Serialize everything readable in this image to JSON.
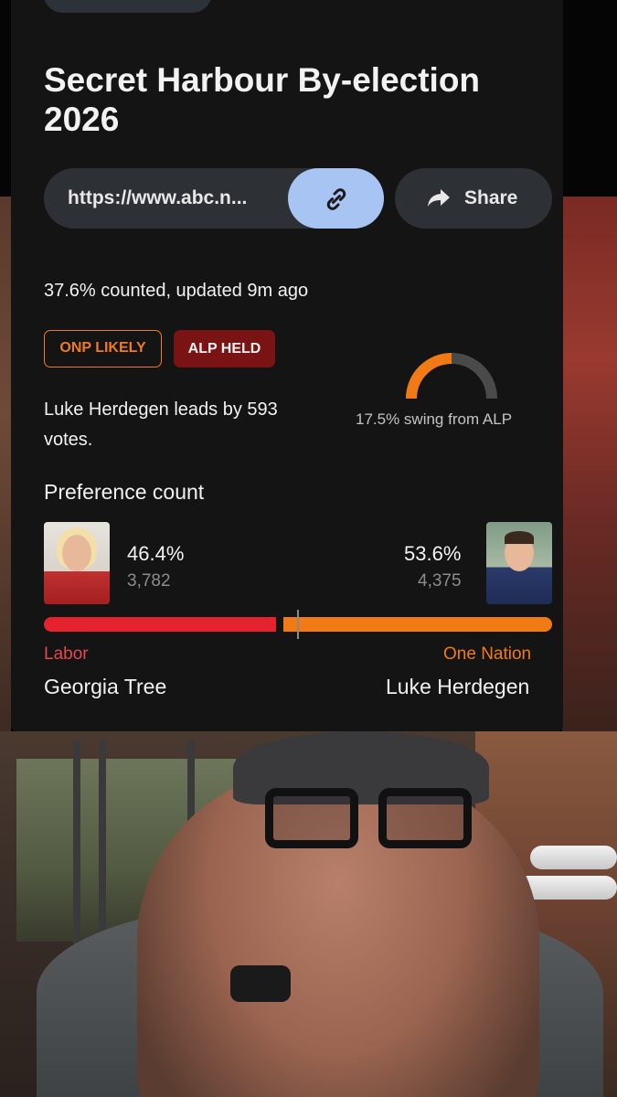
{
  "page": {
    "title": "Secret Harbour By-election 2026",
    "url": "https://www.abc.n...",
    "share_label": "Share",
    "status": "37.6% counted, updated 9m ago"
  },
  "badges": {
    "prediction": "ONP LIKELY",
    "held": "ALP HELD"
  },
  "lead_text": "Luke Herdegen leads by 593 votes.",
  "swing": {
    "label": "17.5% swing from ALP",
    "value_pct": 17.5
  },
  "preference": {
    "title": "Preference count",
    "left": {
      "party": "Labor",
      "candidate": "Georgia Tree",
      "pct": "46.4%",
      "votes": "3,782",
      "share": 46.4
    },
    "right": {
      "party": "One Nation",
      "candidate": "Luke Herdegen",
      "pct": "53.6%",
      "votes": "4,375",
      "share": 53.6
    }
  },
  "icons": {
    "link": "link-icon",
    "share": "share-arrow-icon"
  },
  "colors": {
    "labor": "#e5232e",
    "one_nation": "#f27a14",
    "link_button": "#a8c4f2",
    "alp_held_badge": "#7a1414"
  }
}
